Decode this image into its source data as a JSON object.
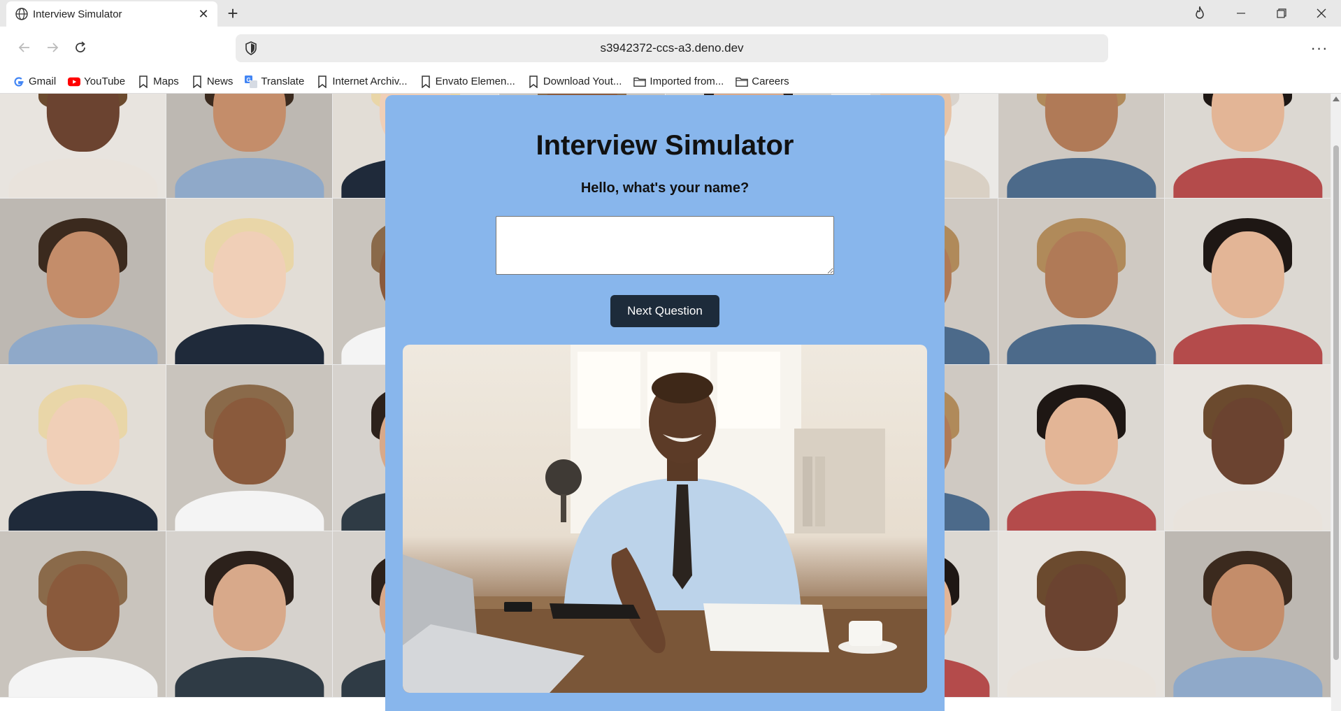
{
  "browser": {
    "tab_title": "Interview Simulator",
    "url": "s3942372-ccs-a3.deno.dev",
    "bookmarks": [
      {
        "label": "Gmail",
        "icon": "gmail-icon"
      },
      {
        "label": "YouTube",
        "icon": "youtube-icon"
      },
      {
        "label": "Maps",
        "icon": "bookmark-icon"
      },
      {
        "label": "News",
        "icon": "bookmark-icon"
      },
      {
        "label": "Translate",
        "icon": "translate-icon"
      },
      {
        "label": "Internet Archiv...",
        "icon": "bookmark-icon"
      },
      {
        "label": "Envato Elemen...",
        "icon": "bookmark-icon"
      },
      {
        "label": "Download Yout...",
        "icon": "bookmark-icon"
      },
      {
        "label": "Imported from...",
        "icon": "folder-icon"
      },
      {
        "label": "Careers",
        "icon": "folder-icon"
      }
    ]
  },
  "page": {
    "title": "Interview Simulator",
    "question": "Hello, what's your name?",
    "answer_value": "",
    "next_button_label": "Next Question",
    "hero_image": "interviewer-handshake-image"
  },
  "colors": {
    "card_bg": "#88b6ec",
    "button_bg": "#1d2b3a",
    "button_text": "#ffffff"
  }
}
